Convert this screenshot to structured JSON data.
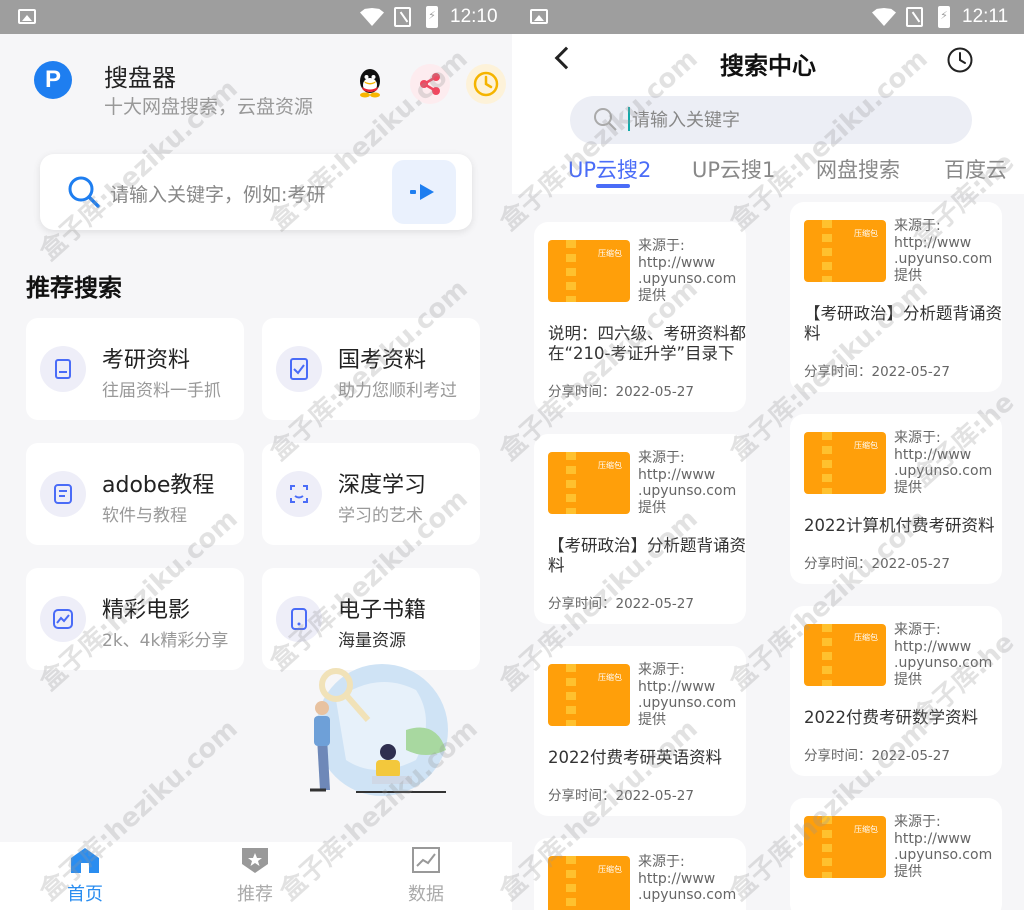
{
  "left": {
    "status": {
      "time": "12:10"
    },
    "app": {
      "logo_letter": "P",
      "name": "搜盘器",
      "subtitle": "十大网盘搜索，云盘资源"
    },
    "header_icons": [
      "qq-icon",
      "share-icon",
      "clock-icon"
    ],
    "search": {
      "placeholder": "请输入关键字，例如:考研"
    },
    "section_title": "推荐搜索",
    "cards": [
      {
        "title": "考研资料",
        "subtitle": "往届资料一手抓",
        "icon": "document-icon"
      },
      {
        "title": "国考资料",
        "subtitle": "助力您顺利考过",
        "icon": "clipboard-check-icon"
      },
      {
        "title": "adobe教程",
        "subtitle": "软件与教程",
        "icon": "tutorial-icon"
      },
      {
        "title": "深度学习",
        "subtitle": "学习的艺术",
        "icon": "scan-face-icon"
      },
      {
        "title": "精彩电影",
        "subtitle": "2k、4k精彩分享",
        "icon": "chart-play-icon"
      },
      {
        "title": "电子书籍",
        "subtitle": "海量资源",
        "icon": "tablet-icon"
      }
    ],
    "nav": [
      {
        "label": "首页",
        "icon": "home-icon",
        "active": true
      },
      {
        "label": "推荐",
        "icon": "shield-star-icon",
        "active": false
      },
      {
        "label": "数据",
        "icon": "chart-icon",
        "active": false
      }
    ]
  },
  "right": {
    "status": {
      "time": "12:11"
    },
    "title": "搜索中心",
    "search": {
      "placeholder": "请输入关键字"
    },
    "tabs": [
      "UP云搜2",
      "UP云搜1",
      "网盘搜索",
      "百度云"
    ],
    "active_tab": 0,
    "source_text": [
      "来源于:",
      "http://www",
      ".upyunso.com",
      "提供"
    ],
    "thumb_label": "压缩包",
    "time_prefix": "分享时间：",
    "results_col1": [
      {
        "desc": "说明：四六级、考研资料都在“210-考证升学”目录下",
        "date": "2022-05-27"
      },
      {
        "desc": "【考研政治】分析题背诵资料",
        "date": "2022-05-27"
      },
      {
        "desc": "2022付费考研英语资料",
        "date": "2022-05-27"
      },
      {
        "desc": "",
        "date": ""
      }
    ],
    "results_col2": [
      {
        "desc": "【考研政治】分析题背诵资料",
        "date": "2022-05-27"
      },
      {
        "desc": "2022计算机付费考研资料",
        "date": "2022-05-27"
      },
      {
        "desc": "2022付费考研数学资料",
        "date": "2022-05-27"
      },
      {
        "desc": "",
        "date": ""
      }
    ]
  },
  "watermark": "盒子库:heziku.com",
  "colors": {
    "accent": "#4a6cf7",
    "brand_blue": "#1e7ef0",
    "thumb_orange": "#ff9f0a",
    "nav_active": "#2a8df0"
  }
}
